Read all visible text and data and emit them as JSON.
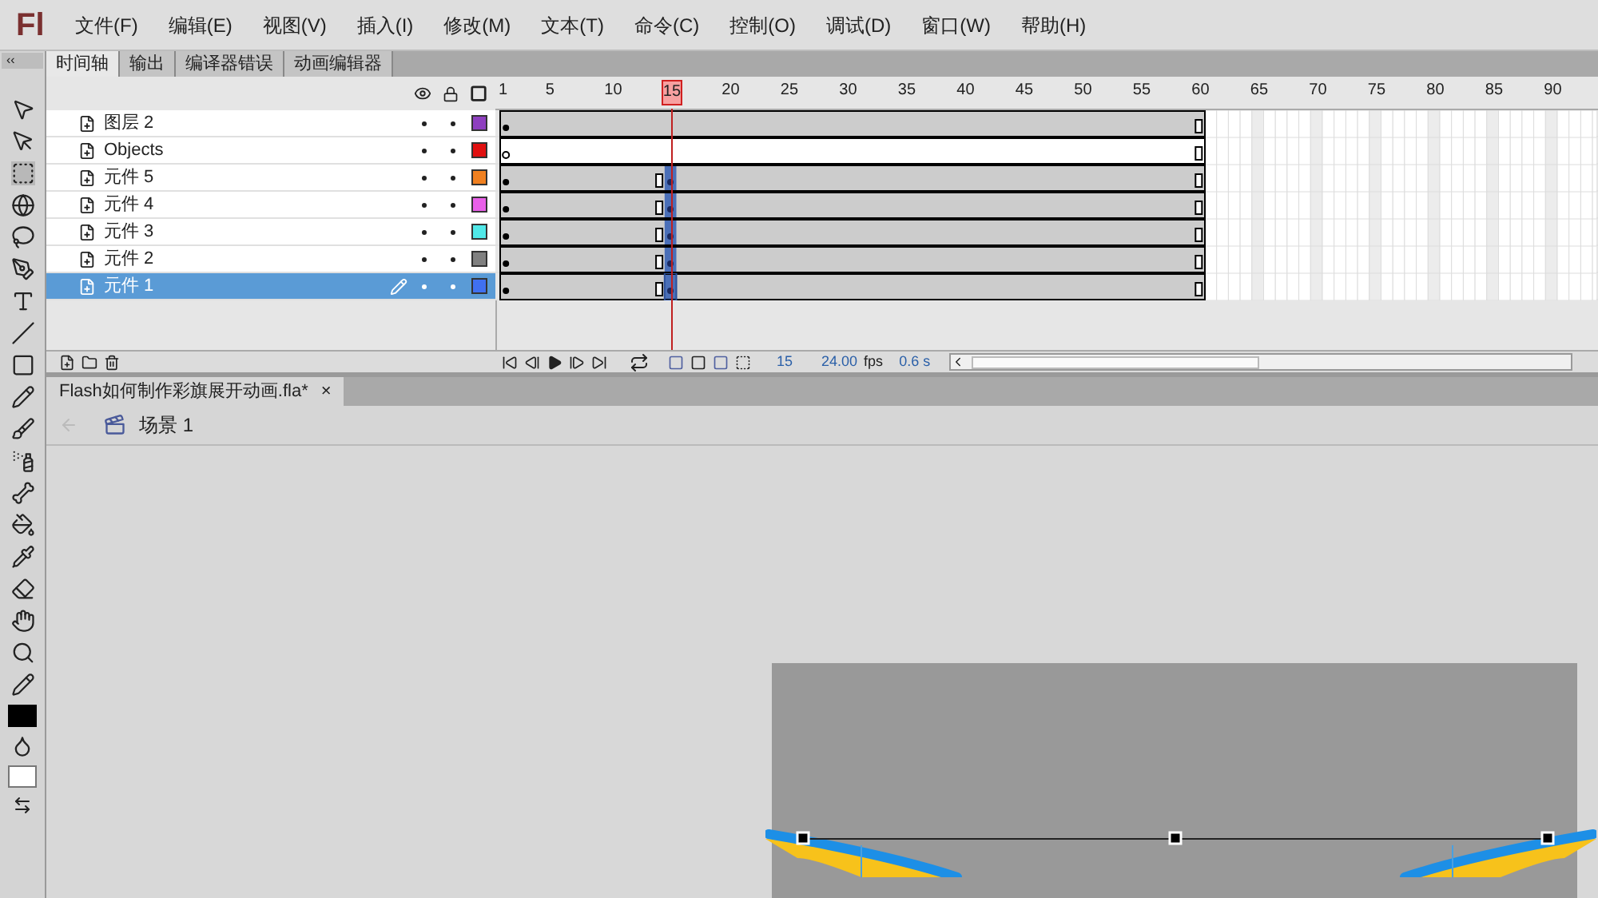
{
  "app_logo": "Fl",
  "menu": [
    "文件(F)",
    "编辑(E)",
    "视图(V)",
    "插入(I)",
    "修改(M)",
    "文本(T)",
    "命令(C)",
    "控制(O)",
    "调试(D)",
    "窗口(W)",
    "帮助(H)"
  ],
  "collapse_label": "‹‹",
  "panel_tabs": [
    {
      "label": "时间轴",
      "selected": true
    },
    {
      "label": "输出",
      "selected": false
    },
    {
      "label": "编译器错误",
      "selected": false
    },
    {
      "label": "动画编辑器",
      "selected": false
    }
  ],
  "timeline": {
    "ruler": [
      "1",
      "5",
      "10",
      "20",
      "25",
      "30",
      "35",
      "40",
      "45",
      "50",
      "55",
      "60",
      "65",
      "70",
      "75",
      "80",
      "85",
      "90"
    ],
    "playhead": "15",
    "layers": [
      {
        "name": "图层 2",
        "color": "#8e3fbf",
        "selected": false,
        "kind": "static"
      },
      {
        "name": "Objects",
        "color": "#e01010",
        "selected": false,
        "kind": "blank"
      },
      {
        "name": "元件 5",
        "color": "#f08020",
        "selected": false,
        "kind": "keyed"
      },
      {
        "name": "元件 4",
        "color": "#e860e8",
        "selected": false,
        "kind": "keyed"
      },
      {
        "name": "元件 3",
        "color": "#50e8e8",
        "selected": false,
        "kind": "keyed"
      },
      {
        "name": "元件 2",
        "color": "#808080",
        "selected": false,
        "kind": "keyed"
      },
      {
        "name": "元件 1",
        "color": "#4070f0",
        "selected": true,
        "kind": "keyed"
      }
    ],
    "status": {
      "frame": "15",
      "fps": "24.00",
      "fps_unit": "fps",
      "time": "0.6 s"
    }
  },
  "document": {
    "tab": "Flash如何制作彩旗展开动画.fla*",
    "close": "×",
    "scene": "场景 1"
  }
}
